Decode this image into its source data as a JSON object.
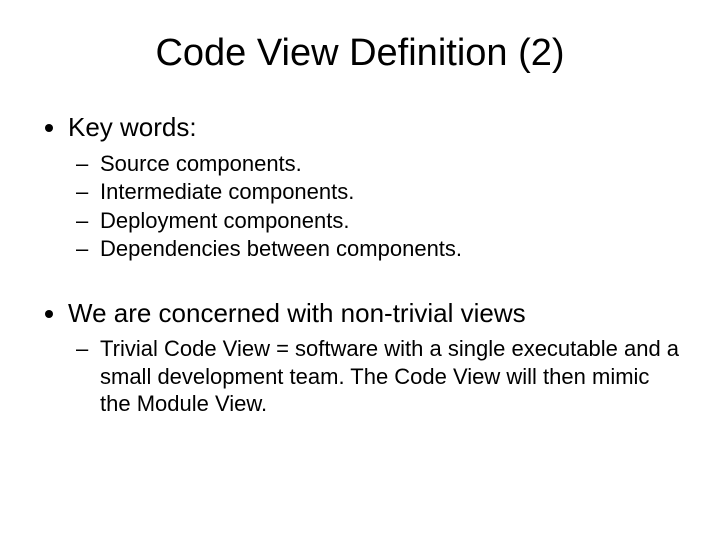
{
  "title": "Code View Definition (2)",
  "bullets": {
    "keywords_label": "Key words:",
    "keywords_items": {
      "a": "Source components.",
      "b": "Intermediate components.",
      "c": "Deployment components.",
      "d": "Dependencies between components."
    },
    "concern_label": "We are concerned with non-trivial views",
    "concern_items": {
      "a": "Trivial Code View = software with a single executable and a small development team. The Code View will then mimic the Module View."
    }
  }
}
